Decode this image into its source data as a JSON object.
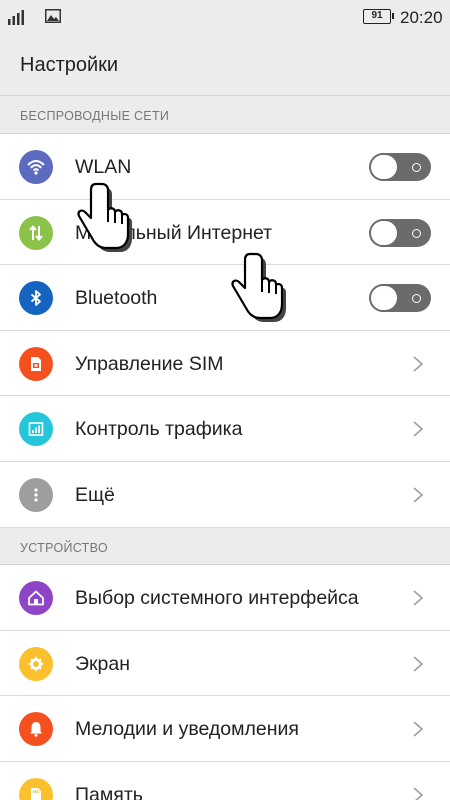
{
  "status_bar": {
    "battery": "91",
    "time": "20:20"
  },
  "header": {
    "title": "Настройки"
  },
  "sections": [
    {
      "title": "БЕСПРОВОДНЫЕ СЕТИ",
      "items": [
        {
          "label": "WLAN",
          "icon": "wifi-icon",
          "color": "#5c6bc0",
          "control": "toggle",
          "state": "off"
        },
        {
          "label": "Мобильный Интернет",
          "icon": "data-arrows-icon",
          "color": "#8bc34a",
          "control": "toggle",
          "state": "off"
        },
        {
          "label": "Bluetooth",
          "icon": "bluetooth-icon",
          "color": "#1565c0",
          "control": "toggle",
          "state": "off"
        },
        {
          "label": "Управление SIM",
          "icon": "sim-card-icon",
          "color": "#f4511e",
          "control": "chevron"
        },
        {
          "label": "Контроль трафика",
          "icon": "traffic-chart-icon",
          "color": "#26c6da",
          "control": "chevron"
        },
        {
          "label": "Ещё",
          "icon": "more-vert-icon",
          "color": "#9e9e9e",
          "control": "chevron"
        }
      ]
    },
    {
      "title": "УСТРОЙСТВО",
      "items": [
        {
          "label": "Выбор системного интерфейса",
          "icon": "home-icon",
          "color": "#8e44c7",
          "control": "chevron"
        },
        {
          "label": "Экран",
          "icon": "brightness-icon",
          "color": "#fbc02d",
          "control": "chevron"
        },
        {
          "label": "Мелодии и уведомления",
          "icon": "bell-icon",
          "color": "#f4511e",
          "control": "chevron"
        },
        {
          "label": "Память",
          "icon": "storage-icon",
          "color": "#fbc02d",
          "control": "chevron"
        }
      ]
    }
  ],
  "colors": {
    "background_gray": "#ececec",
    "toggle_off": "#6b6b6b"
  }
}
